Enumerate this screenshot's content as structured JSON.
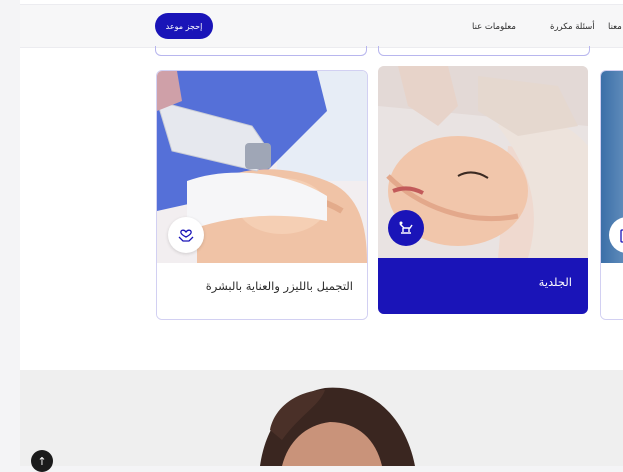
{
  "header": {
    "book_button": "إحجز موعد",
    "nav": {
      "about": "معلومات عنا",
      "faq": "أسئلة مكررة",
      "contact_partial": "معنا"
    }
  },
  "services": [
    {
      "title": "التجميل بالليزر والعناية بالبشرة",
      "icon": "hands-heart-icon",
      "style": "light"
    },
    {
      "title": "الجلدية",
      "icon": "dermatology-chair-icon",
      "style": "dark"
    },
    {
      "title": "",
      "icon": "service-icon",
      "style": "light-partial"
    }
  ],
  "colors": {
    "accent": "#1a14b8",
    "card_border": "#d2d0f2",
    "page_bg": "#ffffff",
    "section_bg": "#efefef"
  },
  "scroll_top": {
    "icon": "arrow-up-icon",
    "glyph": "↑"
  }
}
